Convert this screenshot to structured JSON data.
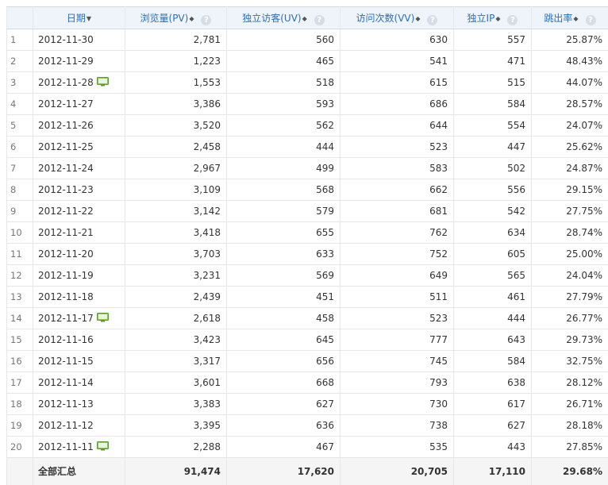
{
  "headers": {
    "date": "日期",
    "pv": "浏览量(PV)",
    "uv": "独立访客(UV)",
    "vv": "访问次数(VV)",
    "ip": "独立IP",
    "bounce": "跳出率"
  },
  "icons": {
    "sort_desc": "sort-desc-icon",
    "sort_both": "sort-icon",
    "help": "help-icon",
    "monitor": "monitor-icon"
  },
  "colors": {
    "header_text": "#2a6fb5",
    "header_bg": "#eef4fa",
    "monitor_icon": "#6fb13a"
  },
  "rows": [
    {
      "idx": "1",
      "date": "2012-11-30",
      "pv": "2,781",
      "uv": "560",
      "vv": "630",
      "ip": "557",
      "bounce": "25.87%",
      "note": false
    },
    {
      "idx": "2",
      "date": "2012-11-29",
      "pv": "1,223",
      "uv": "465",
      "vv": "541",
      "ip": "471",
      "bounce": "48.43%",
      "note": false
    },
    {
      "idx": "3",
      "date": "2012-11-28",
      "pv": "1,553",
      "uv": "518",
      "vv": "615",
      "ip": "515",
      "bounce": "44.07%",
      "note": true
    },
    {
      "idx": "4",
      "date": "2012-11-27",
      "pv": "3,386",
      "uv": "593",
      "vv": "686",
      "ip": "584",
      "bounce": "28.57%",
      "note": false
    },
    {
      "idx": "5",
      "date": "2012-11-26",
      "pv": "3,520",
      "uv": "562",
      "vv": "644",
      "ip": "554",
      "bounce": "24.07%",
      "note": false
    },
    {
      "idx": "6",
      "date": "2012-11-25",
      "pv": "2,458",
      "uv": "444",
      "vv": "523",
      "ip": "447",
      "bounce": "25.62%",
      "note": false
    },
    {
      "idx": "7",
      "date": "2012-11-24",
      "pv": "2,967",
      "uv": "499",
      "vv": "583",
      "ip": "502",
      "bounce": "24.87%",
      "note": false
    },
    {
      "idx": "8",
      "date": "2012-11-23",
      "pv": "3,109",
      "uv": "568",
      "vv": "662",
      "ip": "556",
      "bounce": "29.15%",
      "note": false
    },
    {
      "idx": "9",
      "date": "2012-11-22",
      "pv": "3,142",
      "uv": "579",
      "vv": "681",
      "ip": "542",
      "bounce": "27.75%",
      "note": false
    },
    {
      "idx": "10",
      "date": "2012-11-21",
      "pv": "3,418",
      "uv": "655",
      "vv": "762",
      "ip": "634",
      "bounce": "28.74%",
      "note": false
    },
    {
      "idx": "11",
      "date": "2012-11-20",
      "pv": "3,703",
      "uv": "633",
      "vv": "752",
      "ip": "605",
      "bounce": "25.00%",
      "note": false
    },
    {
      "idx": "12",
      "date": "2012-11-19",
      "pv": "3,231",
      "uv": "569",
      "vv": "649",
      "ip": "565",
      "bounce": "24.04%",
      "note": false
    },
    {
      "idx": "13",
      "date": "2012-11-18",
      "pv": "2,439",
      "uv": "451",
      "vv": "511",
      "ip": "461",
      "bounce": "27.79%",
      "note": false
    },
    {
      "idx": "14",
      "date": "2012-11-17",
      "pv": "2,618",
      "uv": "458",
      "vv": "523",
      "ip": "444",
      "bounce": "26.77%",
      "note": true
    },
    {
      "idx": "15",
      "date": "2012-11-16",
      "pv": "3,423",
      "uv": "645",
      "vv": "777",
      "ip": "643",
      "bounce": "29.73%",
      "note": false
    },
    {
      "idx": "16",
      "date": "2012-11-15",
      "pv": "3,317",
      "uv": "656",
      "vv": "745",
      "ip": "584",
      "bounce": "32.75%",
      "note": false
    },
    {
      "idx": "17",
      "date": "2012-11-14",
      "pv": "3,601",
      "uv": "668",
      "vv": "793",
      "ip": "638",
      "bounce": "28.12%",
      "note": false
    },
    {
      "idx": "18",
      "date": "2012-11-13",
      "pv": "3,383",
      "uv": "627",
      "vv": "730",
      "ip": "617",
      "bounce": "26.71%",
      "note": false
    },
    {
      "idx": "19",
      "date": "2012-11-12",
      "pv": "3,395",
      "uv": "636",
      "vv": "738",
      "ip": "627",
      "bounce": "28.18%",
      "note": false
    },
    {
      "idx": "20",
      "date": "2012-11-11",
      "pv": "2,288",
      "uv": "467",
      "vv": "535",
      "ip": "443",
      "bounce": "27.85%",
      "note": true
    }
  ],
  "total": {
    "label": "全部汇总",
    "pv": "91,474",
    "uv": "17,620",
    "vv": "20,705",
    "ip": "17,110",
    "bounce": "29.68%"
  }
}
